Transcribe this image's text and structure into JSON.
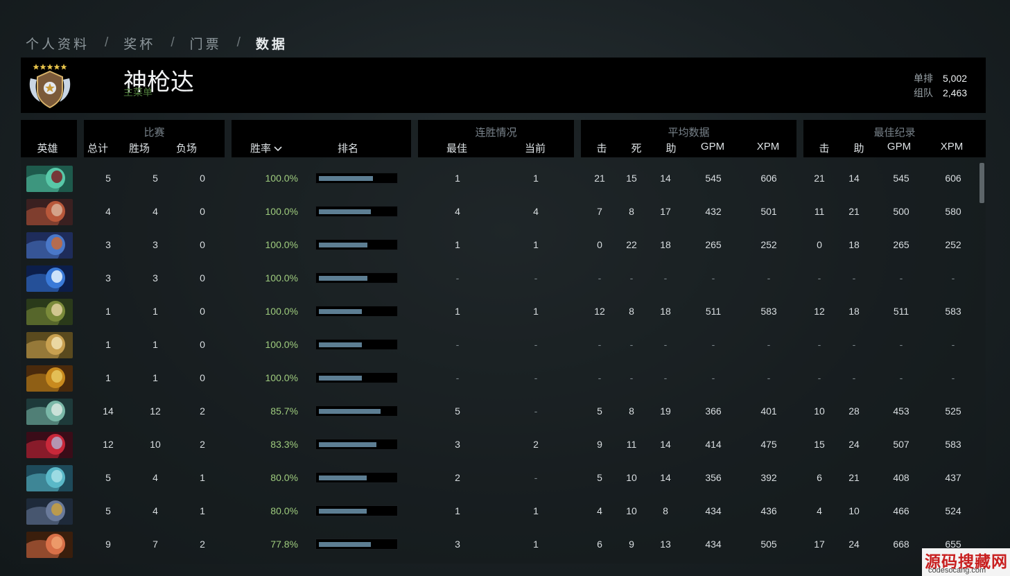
{
  "breadcrumb": [
    "个人资料",
    "奖杯",
    "门票",
    "数据"
  ],
  "breadcrumb_separator": "/",
  "player": {
    "name": "神枪达",
    "subtitle": "主菜单"
  },
  "mmr": [
    {
      "label": "单排",
      "value": "5,002"
    },
    {
      "label": "组队",
      "value": "2,463"
    }
  ],
  "headers": {
    "hero": "英雄",
    "matches": {
      "group": "比赛",
      "total": "总计",
      "wins": "胜场",
      "losses": "负场"
    },
    "winrate": "胜率",
    "rank": "排名",
    "streak": {
      "group": "连胜情况",
      "best": "最佳",
      "current": "当前"
    },
    "average": {
      "group": "平均数据",
      "kills": "击",
      "deaths": "死",
      "assists": "助",
      "gpm": "GPM",
      "xpm": "XPM"
    },
    "best": {
      "group": "最佳纪录",
      "kills": "击",
      "assists": "助",
      "gpm": "GPM",
      "xpm": "XPM"
    }
  },
  "rows": [
    {
      "hero_icon": "hero-portrait-teal-female",
      "total": "5",
      "wins": "5",
      "losses": "0",
      "winrate": "100.0%",
      "rank_fraction": 0.7,
      "streak_best": "1",
      "streak_current": "1",
      "avg_k": "21",
      "avg_d": "15",
      "avg_a": "14",
      "avg_gpm": "545",
      "avg_xpm": "606",
      "best_k": "21",
      "best_a": "14",
      "best_gpm": "545",
      "best_xpm": "606"
    },
    {
      "hero_icon": "hero-portrait-monkey",
      "total": "4",
      "wins": "4",
      "losses": "0",
      "winrate": "100.0%",
      "rank_fraction": 0.68,
      "streak_best": "4",
      "streak_current": "4",
      "avg_k": "7",
      "avg_d": "8",
      "avg_a": "17",
      "avg_gpm": "432",
      "avg_xpm": "501",
      "best_k": "11",
      "best_a": "21",
      "best_gpm": "500",
      "best_xpm": "580"
    },
    {
      "hero_icon": "hero-portrait-armored-rider",
      "total": "3",
      "wins": "3",
      "losses": "0",
      "winrate": "100.0%",
      "rank_fraction": 0.63,
      "streak_best": "1",
      "streak_current": "1",
      "avg_k": "0",
      "avg_d": "22",
      "avg_a": "18",
      "avg_gpm": "265",
      "avg_xpm": "252",
      "best_k": "0",
      "best_a": "18",
      "best_gpm": "265",
      "best_xpm": "252"
    },
    {
      "hero_icon": "hero-portrait-light-spirit",
      "total": "3",
      "wins": "3",
      "losses": "0",
      "winrate": "100.0%",
      "rank_fraction": 0.63,
      "streak_best": "-",
      "streak_current": "-",
      "avg_k": "-",
      "avg_d": "-",
      "avg_a": "-",
      "avg_gpm": "-",
      "avg_xpm": "-",
      "best_k": "-",
      "best_a": "-",
      "best_gpm": "-",
      "best_xpm": "-"
    },
    {
      "hero_icon": "hero-portrait-nature-prophet",
      "total": "1",
      "wins": "1",
      "losses": "0",
      "winrate": "100.0%",
      "rank_fraction": 0.56,
      "streak_best": "1",
      "streak_current": "1",
      "avg_k": "12",
      "avg_d": "8",
      "avg_a": "18",
      "avg_gpm": "511",
      "avg_xpm": "583",
      "best_k": "12",
      "best_a": "18",
      "best_gpm": "511",
      "best_xpm": "583"
    },
    {
      "hero_icon": "hero-portrait-bearded-elder",
      "total": "1",
      "wins": "1",
      "losses": "0",
      "winrate": "100.0%",
      "rank_fraction": 0.56,
      "streak_best": "-",
      "streak_current": "-",
      "avg_k": "-",
      "avg_d": "-",
      "avg_a": "-",
      "avg_gpm": "-",
      "avg_xpm": "-",
      "best_k": "-",
      "best_a": "-",
      "best_gpm": "-",
      "best_xpm": "-"
    },
    {
      "hero_icon": "hero-portrait-golden-warrior",
      "total": "1",
      "wins": "1",
      "losses": "0",
      "winrate": "100.0%",
      "rank_fraction": 0.56,
      "streak_best": "-",
      "streak_current": "-",
      "avg_k": "-",
      "avg_d": "-",
      "avg_a": "-",
      "avg_gpm": "-",
      "avg_xpm": "-",
      "best_k": "-",
      "best_a": "-",
      "best_gpm": "-",
      "best_xpm": "-"
    },
    {
      "hero_icon": "hero-portrait-horned-druid",
      "total": "14",
      "wins": "12",
      "losses": "2",
      "winrate": "85.7%",
      "rank_fraction": 0.8,
      "streak_best": "5",
      "streak_current": "-",
      "avg_k": "5",
      "avg_d": "8",
      "avg_a": "19",
      "avg_gpm": "366",
      "avg_xpm": "401",
      "best_k": "10",
      "best_a": "28",
      "best_gpm": "453",
      "best_xpm": "525"
    },
    {
      "hero_icon": "hero-portrait-pale-queen",
      "total": "12",
      "wins": "10",
      "losses": "2",
      "winrate": "83.3%",
      "rank_fraction": 0.75,
      "streak_best": "3",
      "streak_current": "2",
      "avg_k": "9",
      "avg_d": "11",
      "avg_a": "14",
      "avg_gpm": "414",
      "avg_xpm": "475",
      "best_k": "15",
      "best_a": "24",
      "best_gpm": "507",
      "best_xpm": "583"
    },
    {
      "hero_icon": "hero-portrait-ice-dragon",
      "total": "5",
      "wins": "4",
      "losses": "1",
      "winrate": "80.0%",
      "rank_fraction": 0.62,
      "streak_best": "2",
      "streak_current": "-",
      "avg_k": "5",
      "avg_d": "10",
      "avg_a": "14",
      "avg_gpm": "356",
      "avg_xpm": "392",
      "best_k": "6",
      "best_a": "21",
      "best_gpm": "408",
      "best_xpm": "437"
    },
    {
      "hero_icon": "hero-portrait-hooded-tinker",
      "total": "5",
      "wins": "4",
      "losses": "1",
      "winrate": "80.0%",
      "rank_fraction": 0.62,
      "streak_best": "1",
      "streak_current": "1",
      "avg_k": "4",
      "avg_d": "10",
      "avg_a": "8",
      "avg_gpm": "434",
      "avg_xpm": "436",
      "best_k": "4",
      "best_a": "10",
      "best_gpm": "466",
      "best_xpm": "524"
    },
    {
      "hero_icon": "hero-portrait-red-brute",
      "total": "9",
      "wins": "7",
      "losses": "2",
      "winrate": "77.8%",
      "rank_fraction": 0.68,
      "streak_best": "3",
      "streak_current": "1",
      "avg_k": "6",
      "avg_d": "9",
      "avg_a": "13",
      "avg_gpm": "434",
      "avg_xpm": "505",
      "best_k": "17",
      "best_a": "24",
      "best_gpm": "668",
      "best_xpm": "655"
    }
  ],
  "watermark": {
    "main": "源码搜藏网",
    "sub": "codesocang.com"
  },
  "colors": {
    "header_bg": "#000000",
    "win_rate": "#9fcc7e",
    "rank_bar": "#5d7e93",
    "subtitle": "#4d7a3a",
    "watermark": "#c81f1f"
  }
}
